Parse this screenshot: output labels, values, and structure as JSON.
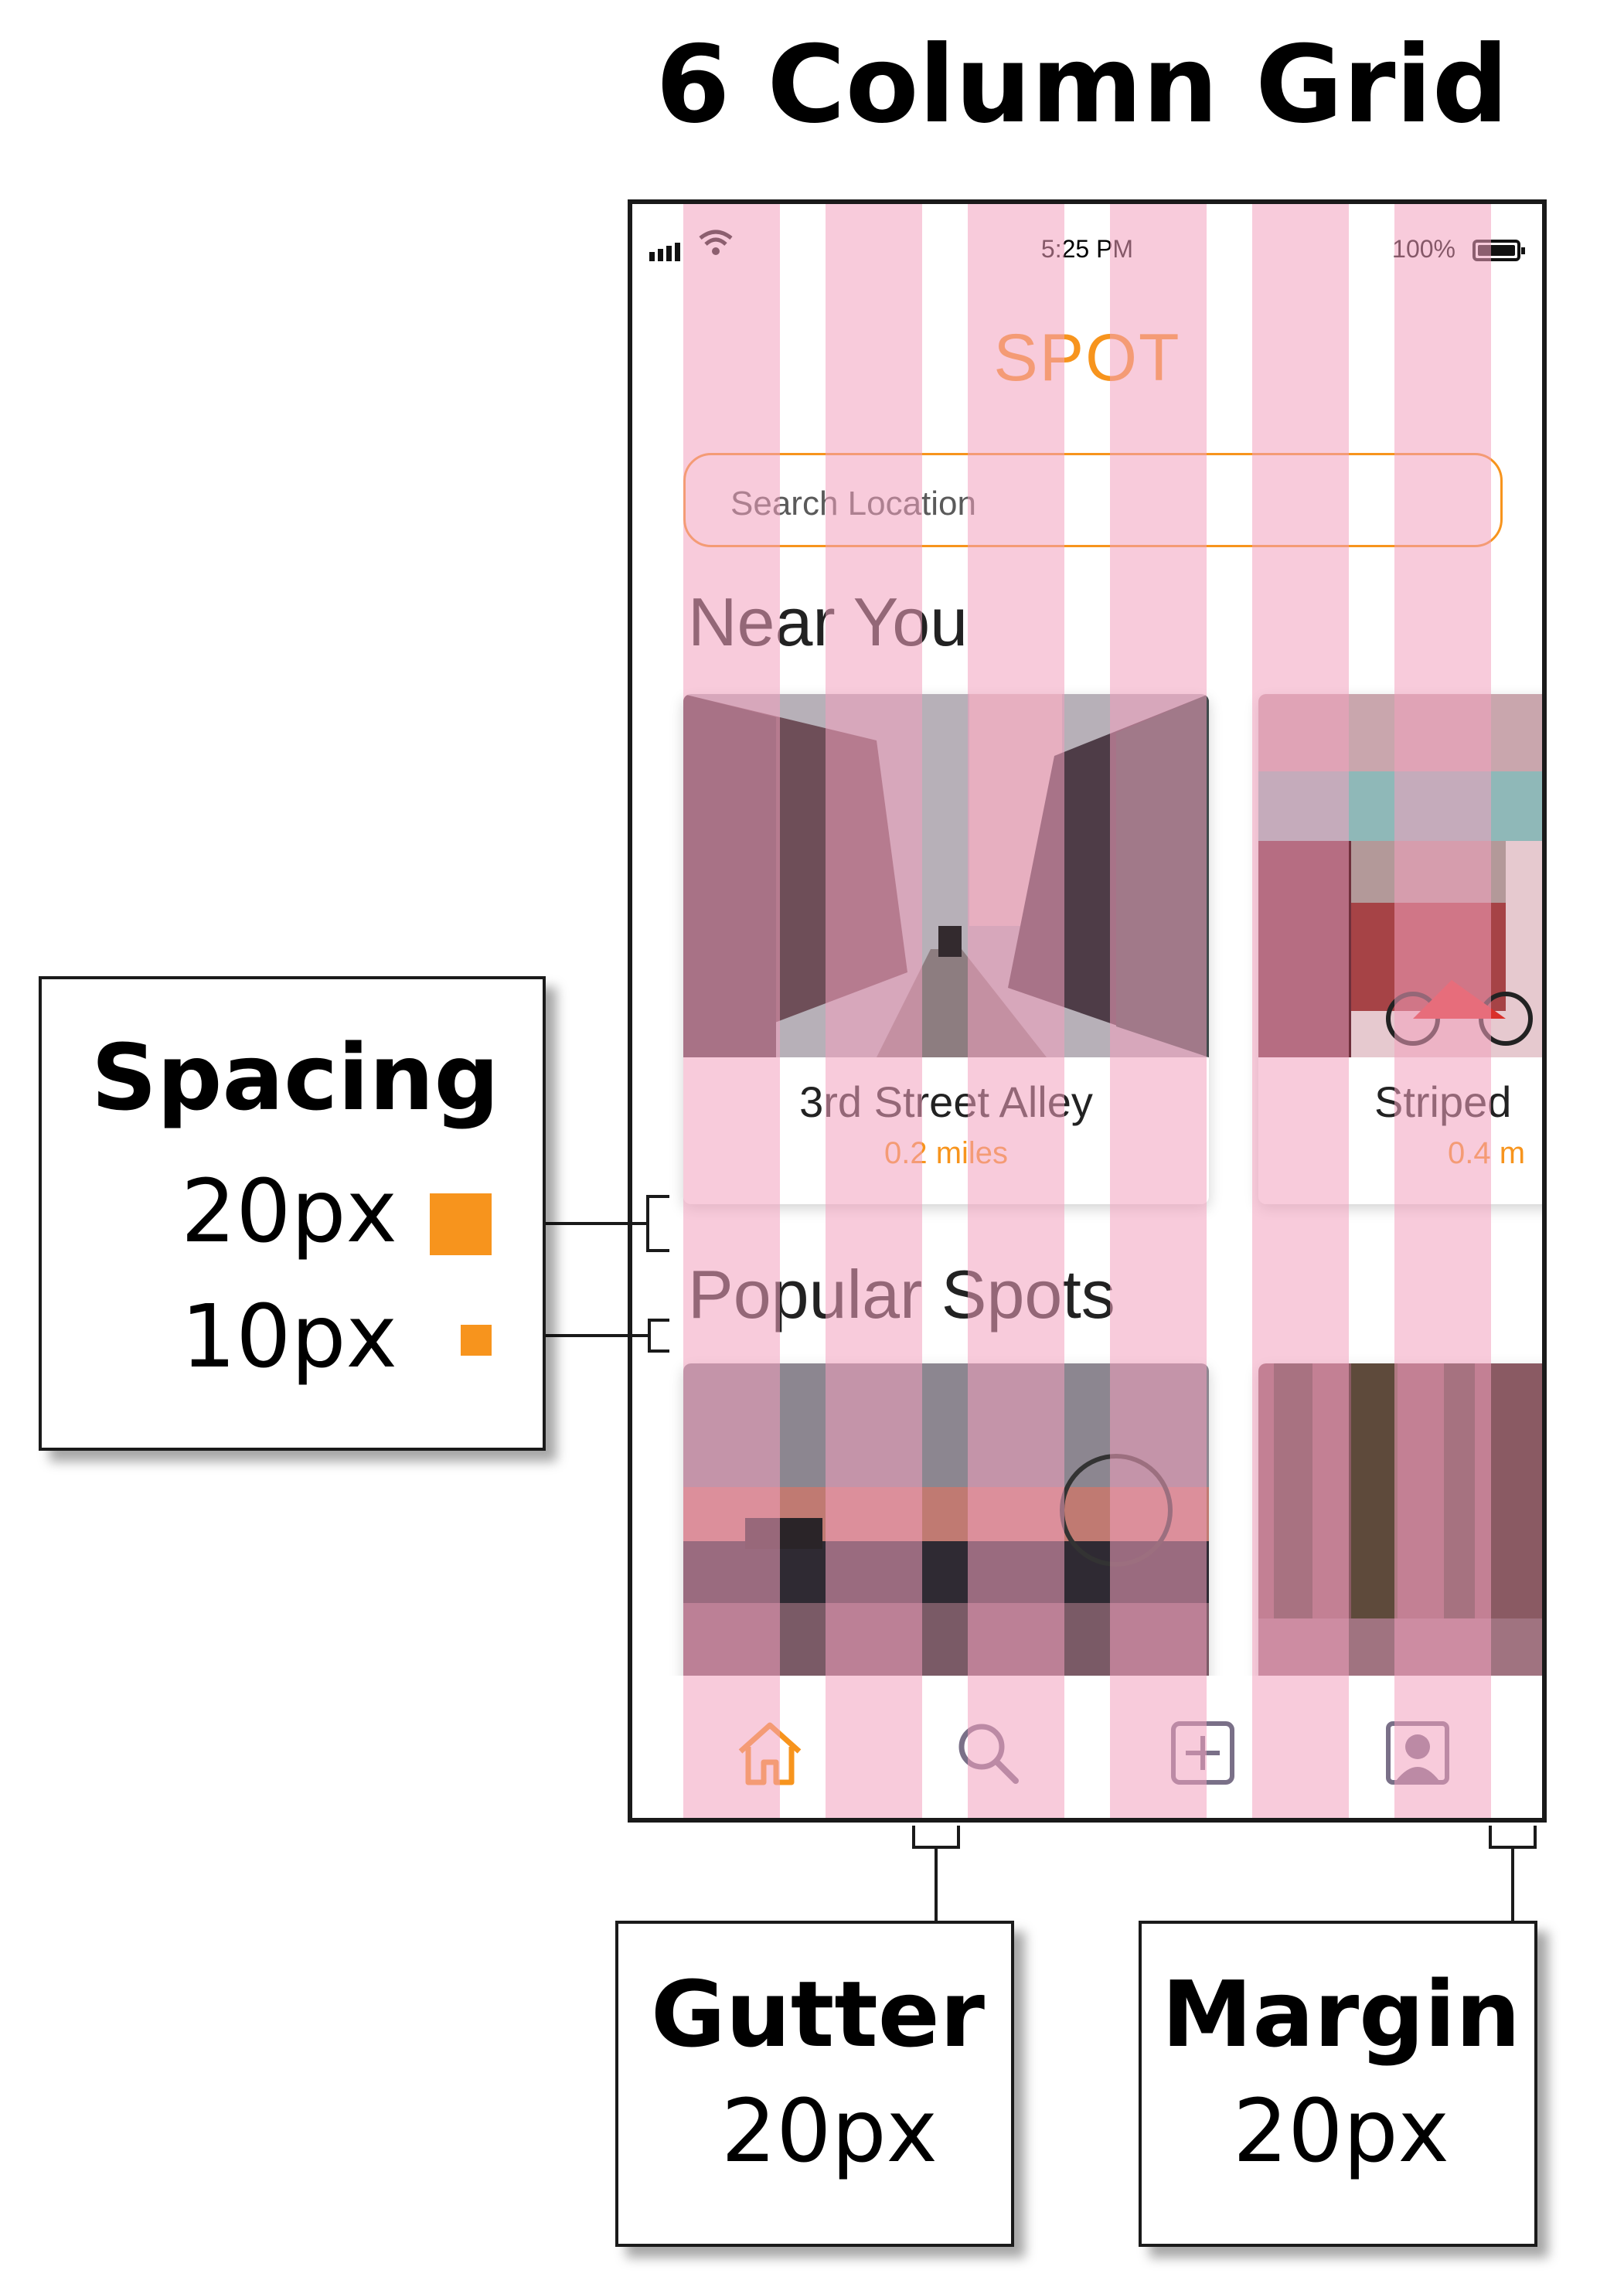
{
  "title": "6 Column Grid",
  "phone": {
    "status_time": "5:25 PM",
    "status_battery": "100%",
    "app_title": "SPOT",
    "search_placeholder": "Search Location",
    "near_you_title": "Near You",
    "near_you_cards": [
      {
        "name": "3rd Street Alley",
        "distance": "0.2 miles"
      },
      {
        "name": "Striped",
        "distance": "0.4 m"
      }
    ],
    "popular_title": "Popular Spots",
    "nav_items": [
      "home-icon",
      "search-icon",
      "add-icon",
      "profile-icon"
    ]
  },
  "annotations": {
    "spacing": {
      "title": "Spacing",
      "large": "20px",
      "small": "10px"
    },
    "gutter": {
      "title": "Gutter",
      "value": "20px"
    },
    "margin": {
      "title": "Margin",
      "value": "20px"
    }
  },
  "colors": {
    "accent": "#f7941d",
    "grid_column": "#f2a0be"
  }
}
